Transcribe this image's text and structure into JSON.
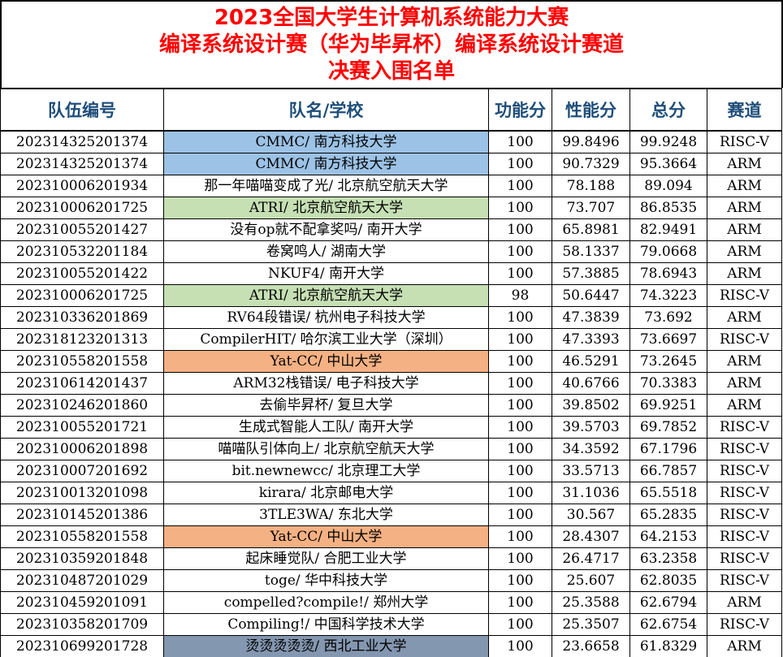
{
  "title": {
    "line1": "2023全国大学生计算机系统能力大赛",
    "line2": "编译系统设计赛（华为毕昇杯）编译系统设计赛道",
    "line3": "决赛入围名单"
  },
  "colors": {
    "title": "#ff0000",
    "header_text": "#1f4e79",
    "blue": "#9cc2e5",
    "green": "#c6e0b4",
    "orange": "#f4b183",
    "slate": "#8497b0"
  },
  "table": {
    "headers": [
      "队伍编号",
      "队名/学校",
      "功能分",
      "性能分",
      "总分",
      "赛道"
    ],
    "rows": [
      {
        "id": "202314325201374",
        "name": "CMMC/ 南方科技大学",
        "func": "100",
        "perf": "99.8496",
        "total": "99.9248",
        "track": "RISC-V",
        "hl": "blue"
      },
      {
        "id": "202314325201374",
        "name": "CMMC/ 南方科技大学",
        "func": "100",
        "perf": "90.7329",
        "total": "95.3664",
        "track": "ARM",
        "hl": "blue"
      },
      {
        "id": "202310006201934",
        "name": "那一年喵喵变成了光/ 北京航空航天大学",
        "func": "100",
        "perf": "78.188",
        "total": "89.094",
        "track": "ARM",
        "hl": ""
      },
      {
        "id": "202310006201725",
        "name": "ATRI/ 北京航空航天大学",
        "func": "100",
        "perf": "73.707",
        "total": "86.8535",
        "track": "ARM",
        "hl": "green"
      },
      {
        "id": "202310055201427",
        "name": "没有op就不配拿奖吗/ 南开大学",
        "func": "100",
        "perf": "65.8981",
        "total": "82.9491",
        "track": "ARM",
        "hl": ""
      },
      {
        "id": "202310532201184",
        "name": "卷窝鸣人/ 湖南大学",
        "func": "100",
        "perf": "58.1337",
        "total": "79.0668",
        "track": "ARM",
        "hl": ""
      },
      {
        "id": "202310055201422",
        "name": "NKUF4/ 南开大学",
        "func": "100",
        "perf": "57.3885",
        "total": "78.6943",
        "track": "ARM",
        "hl": ""
      },
      {
        "id": "202310006201725",
        "name": "ATRI/ 北京航空航天大学",
        "func": "98",
        "perf": "50.6447",
        "total": "74.3223",
        "track": "RISC-V",
        "hl": "green"
      },
      {
        "id": "202310336201869",
        "name": "RV64段错误/ 杭州电子科技大学",
        "func": "100",
        "perf": "47.3839",
        "total": "73.692",
        "track": "ARM",
        "hl": ""
      },
      {
        "id": "202318123201313",
        "name": "CompilerHIT/ 哈尔滨工业大学（深圳）",
        "func": "100",
        "perf": "47.3393",
        "total": "73.6697",
        "track": "RISC-V",
        "hl": ""
      },
      {
        "id": "202310558201558",
        "name": "Yat-CC/ 中山大学",
        "func": "100",
        "perf": "46.5291",
        "total": "73.2645",
        "track": "ARM",
        "hl": "orange"
      },
      {
        "id": "202310614201437",
        "name": "ARM32栈错误/ 电子科技大学",
        "func": "100",
        "perf": "40.6766",
        "total": "70.3383",
        "track": "ARM",
        "hl": ""
      },
      {
        "id": "202310246201860",
        "name": "去偷毕昇杯/ 复旦大学",
        "func": "100",
        "perf": "39.8502",
        "total": "69.9251",
        "track": "ARM",
        "hl": ""
      },
      {
        "id": "202310055201721",
        "name": "生成式智能人工队/ 南开大学",
        "func": "100",
        "perf": "39.5703",
        "total": "69.7852",
        "track": "RISC-V",
        "hl": ""
      },
      {
        "id": "202310006201898",
        "name": "喵喵队引体向上/ 北京航空航天大学",
        "func": "100",
        "perf": "34.3592",
        "total": "67.1796",
        "track": "RISC-V",
        "hl": ""
      },
      {
        "id": "202310007201692",
        "name": "bit.newnewcc/ 北京理工大学",
        "func": "100",
        "perf": "33.5713",
        "total": "66.7857",
        "track": "RISC-V",
        "hl": ""
      },
      {
        "id": "202310013201098",
        "name": "kirara/ 北京邮电大学",
        "func": "100",
        "perf": "31.1036",
        "total": "65.5518",
        "track": "RISC-V",
        "hl": ""
      },
      {
        "id": "202310145201386",
        "name": "3TLE3WA/ 东北大学",
        "func": "100",
        "perf": "30.567",
        "total": "65.2835",
        "track": "RISC-V",
        "hl": ""
      },
      {
        "id": "202310558201558",
        "name": "Yat-CC/ 中山大学",
        "func": "100",
        "perf": "28.4307",
        "total": "64.2153",
        "track": "RISC-V",
        "hl": "orange"
      },
      {
        "id": "202310359201848",
        "name": "起床睡觉队/ 合肥工业大学",
        "func": "100",
        "perf": "26.4717",
        "total": "63.2358",
        "track": "RISC-V",
        "hl": ""
      },
      {
        "id": "202310487201029",
        "name": "toge/ 华中科技大学",
        "func": "100",
        "perf": "25.607",
        "total": "62.8035",
        "track": "RISC-V",
        "hl": ""
      },
      {
        "id": "202310459201091",
        "name": "compelled?compile!/ 郑州大学",
        "func": "100",
        "perf": "25.3588",
        "total": "62.6794",
        "track": "ARM",
        "hl": ""
      },
      {
        "id": "202310358201709",
        "name": "Compiling!/ 中国科学技术大学",
        "func": "100",
        "perf": "25.3507",
        "total": "62.6754",
        "track": "RISC-V",
        "hl": ""
      },
      {
        "id": "202310699201728",
        "name": "烫烫烫烫烫/ 西北工业大学",
        "func": "100",
        "perf": "23.6658",
        "total": "61.8329",
        "track": "ARM",
        "hl": "slate"
      }
    ]
  }
}
